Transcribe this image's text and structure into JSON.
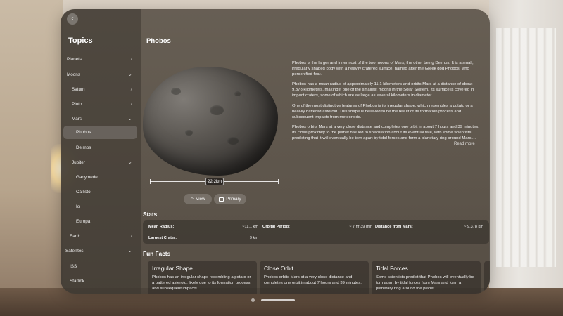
{
  "sidebar": {
    "title": "Topics",
    "items": [
      {
        "label": "Planets",
        "chevron": "right"
      },
      {
        "label": "Moons",
        "chevron": "down"
      },
      {
        "label": "Saturn",
        "chevron": "right"
      },
      {
        "label": "Pluto",
        "chevron": "right"
      },
      {
        "label": "Mars",
        "chevron": "down"
      },
      {
        "label": "Phobos",
        "selected": true
      },
      {
        "label": "Deimos"
      },
      {
        "label": "Jupiter",
        "chevron": "down"
      },
      {
        "label": "Ganymede"
      },
      {
        "label": "Callisto"
      },
      {
        "label": "Io"
      },
      {
        "label": "Europa"
      },
      {
        "label": "Earth",
        "chevron": "right"
      },
      {
        "label": "Satellites",
        "chevron": "down"
      },
      {
        "label": "ISS"
      },
      {
        "label": "Starlink"
      }
    ]
  },
  "main": {
    "title": "Phobos",
    "scale_label": "22.2km",
    "buttons": {
      "view": "View",
      "primary": "Primary"
    },
    "description": [
      "Phobos is the larger and innermost of the two moons of Mars, the other being Deimos. It is a small, irregularly shaped body with a heavily cratered surface, named after the Greek god Phobos, who personified fear.",
      "Phobos has a mean radius of approximately 11.1 kilometers and orbits Mars at a distance of about 9,378 kilometers, making it one of the smallest moons in the Solar System. Its surface is covered in impact craters, some of which are as large as several kilometers in diameter.",
      "One of the most distinctive features of Phobos is its irregular shape, which resembles a potato or a heavily battered asteroid. This shape is believed to be the result of its formation process and subsequent impacts from meteoroids.",
      "Phobos orbits Mars at a very close distance and completes one orbit in about 7 hours and 39 minutes. Its close proximity to the planet has led to speculation about its eventual fate, with some scientists predicting that it will eventually be torn apart by tidal forces and form a planetary ring around Mars...."
    ],
    "read_more": "Read more",
    "stats_title": "Stats",
    "stats": {
      "mean_radius": {
        "label": "Mean Radius:",
        "value": "~11.1 km"
      },
      "orbital_period": {
        "label": "Orbital Period:",
        "value": "~ 7 hr 39 min"
      },
      "distance": {
        "label": "Distance from Mars:",
        "value": "~ 9,378 km"
      },
      "largest_crater": {
        "label": "Largest Crater:",
        "value": "9 km"
      }
    },
    "fun_facts_title": "Fun Facts",
    "fun_facts": [
      {
        "title": "Irregular Shape",
        "text": "Phobos has an irregular shape resembling a potato or a battered asteroid, likely due to its formation process and subsequent impacts."
      },
      {
        "title": "Close Orbit",
        "text": "Phobos orbits Mars at a very close distance and completes one orbit in about 7 hours and 39 minutes."
      },
      {
        "title": "Tidal Forces",
        "text": "Some scientists predict that Phobos will eventually be torn apart by tidal forces from Mars and form a planetary ring around the planet."
      }
    ]
  }
}
